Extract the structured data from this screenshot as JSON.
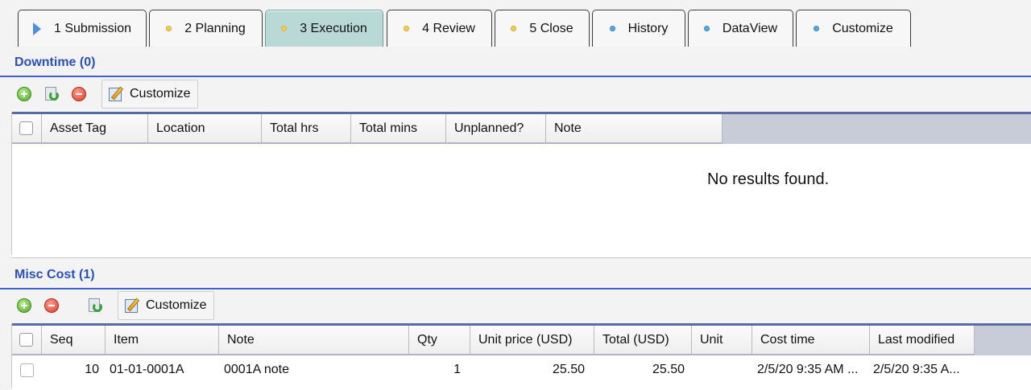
{
  "tabs": [
    {
      "label": "1 Submission",
      "marker": "play-icon",
      "active": false
    },
    {
      "label": "2 Planning",
      "marker": "yellow-dot",
      "active": false
    },
    {
      "label": "3 Execution",
      "marker": "yellow-dot",
      "active": true
    },
    {
      "label": "4 Review",
      "marker": "yellow-dot",
      "active": false
    },
    {
      "label": "5 Close",
      "marker": "yellow-dot",
      "active": false
    },
    {
      "label": "History",
      "marker": "blue-dot",
      "active": false
    },
    {
      "label": "DataView",
      "marker": "blue-dot",
      "active": false
    },
    {
      "label": "Customize",
      "marker": "blue-dot",
      "active": false
    }
  ],
  "downtime": {
    "title": "Downtime (0)",
    "toolbar": {
      "icons": [
        "add-icon",
        "refresh-icon",
        "remove-icon"
      ],
      "customize_label": "Customize"
    },
    "columns": [
      "Asset Tag",
      "Location",
      "Total hrs",
      "Total mins",
      "Unplanned?",
      "Note"
    ],
    "empty_message": "No results found."
  },
  "misc_cost": {
    "title": "Misc Cost (1)",
    "toolbar": {
      "icons": [
        "add-icon",
        "remove-icon",
        "refresh-icon"
      ],
      "customize_label": "Customize"
    },
    "columns": [
      "Seq",
      "Item",
      "Note",
      "Qty",
      "Unit price (USD)",
      "Total (USD)",
      "Unit",
      "Cost time",
      "Last modified"
    ],
    "rows": [
      {
        "seq": "10",
        "item": "01-01-0001A",
        "note": "0001A note",
        "qty": "1",
        "unit_price": "25.50",
        "total": "25.50",
        "unit": "",
        "cost_time": "2/5/20 9:35 AM ...",
        "last_modified": "2/5/20 9:35 A..."
      }
    ]
  },
  "colors": {
    "accent_title": "#2c4fb9",
    "active_tab": "#b8d9d6",
    "header_band": "#c8cbd8"
  }
}
